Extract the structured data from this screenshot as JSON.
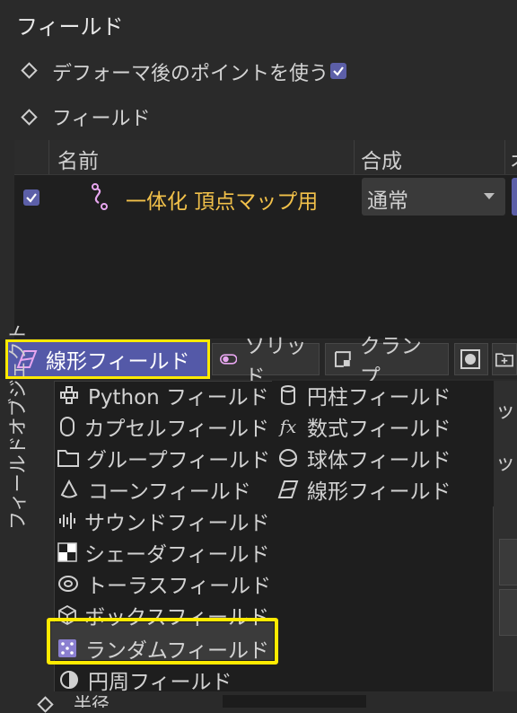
{
  "section_title": "フィールド",
  "props": {
    "use_deformed_points_label": "デフォーマ後のポイントを使う",
    "fields_label": "フィールド"
  },
  "table": {
    "col_name": "名前",
    "col_blend": "合成",
    "col_third_partial": "オ",
    "row": {
      "name": "一体化 頂点マップ用",
      "blend_mode": "通常"
    }
  },
  "toolbar": {
    "linear_field_label": "線形フィールド",
    "solid_label": "ソリッド",
    "clamp_label": "クランプ"
  },
  "side_tab_label": "フィールドオブジェクト",
  "menu": {
    "col1": [
      "Python フィールド",
      "カプセルフィールド",
      "グループフィールド",
      "コーンフィールド",
      "サウンドフィールド",
      "シェーダフィールド",
      "トーラスフィールド",
      "ボックスフィールド",
      "ランダムフィールド",
      "円周フィールド"
    ],
    "col2": [
      "円柱フィールド",
      "数式フィールド",
      "球体フィールド",
      "線形フィールド"
    ]
  },
  "right_edge_fragments": [
    "ップ",
    "ップ"
  ],
  "bottom_fragment": "半径",
  "colors": {
    "accent": "#5459a8",
    "highlight_border": "#ffea00",
    "field_name": "#f2c14a",
    "icon_pink": "#e7a6ef"
  }
}
